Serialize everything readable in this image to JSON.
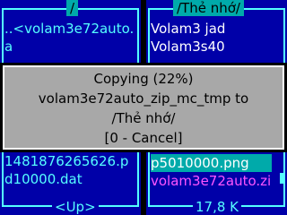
{
  "left_panel": {
    "title": "/",
    "files_top": [
      "..<volam3e72auto.",
      "a"
    ],
    "files_bottom": [
      "1481876265626.p",
      "d10000.dat"
    ],
    "bottom_label": "<Up>"
  },
  "right_panel": {
    "title": "/Thẻ nhớ/",
    "files_top": [
      "Volam3 jad",
      "Volam3s40"
    ],
    "selected_file": "p5010000.png",
    "last_file": "volam3e72auto.zi",
    "bottom_label": "17,8 K"
  },
  "dialog": {
    "line1": "Copying (22%)",
    "line2": "volam3e72auto_zip_mc_tmp to",
    "line3": "/Thẻ nhớ/",
    "line4": "[0 - Cancel]",
    "progress_percent": 22
  },
  "colors": {
    "panel_bg": "#0000a8",
    "accent_cyan": "#55ffff",
    "title_bg": "#00aaaa",
    "dialog_bg": "#a8a8a8",
    "highlight_magenta": "#ff55ff"
  }
}
